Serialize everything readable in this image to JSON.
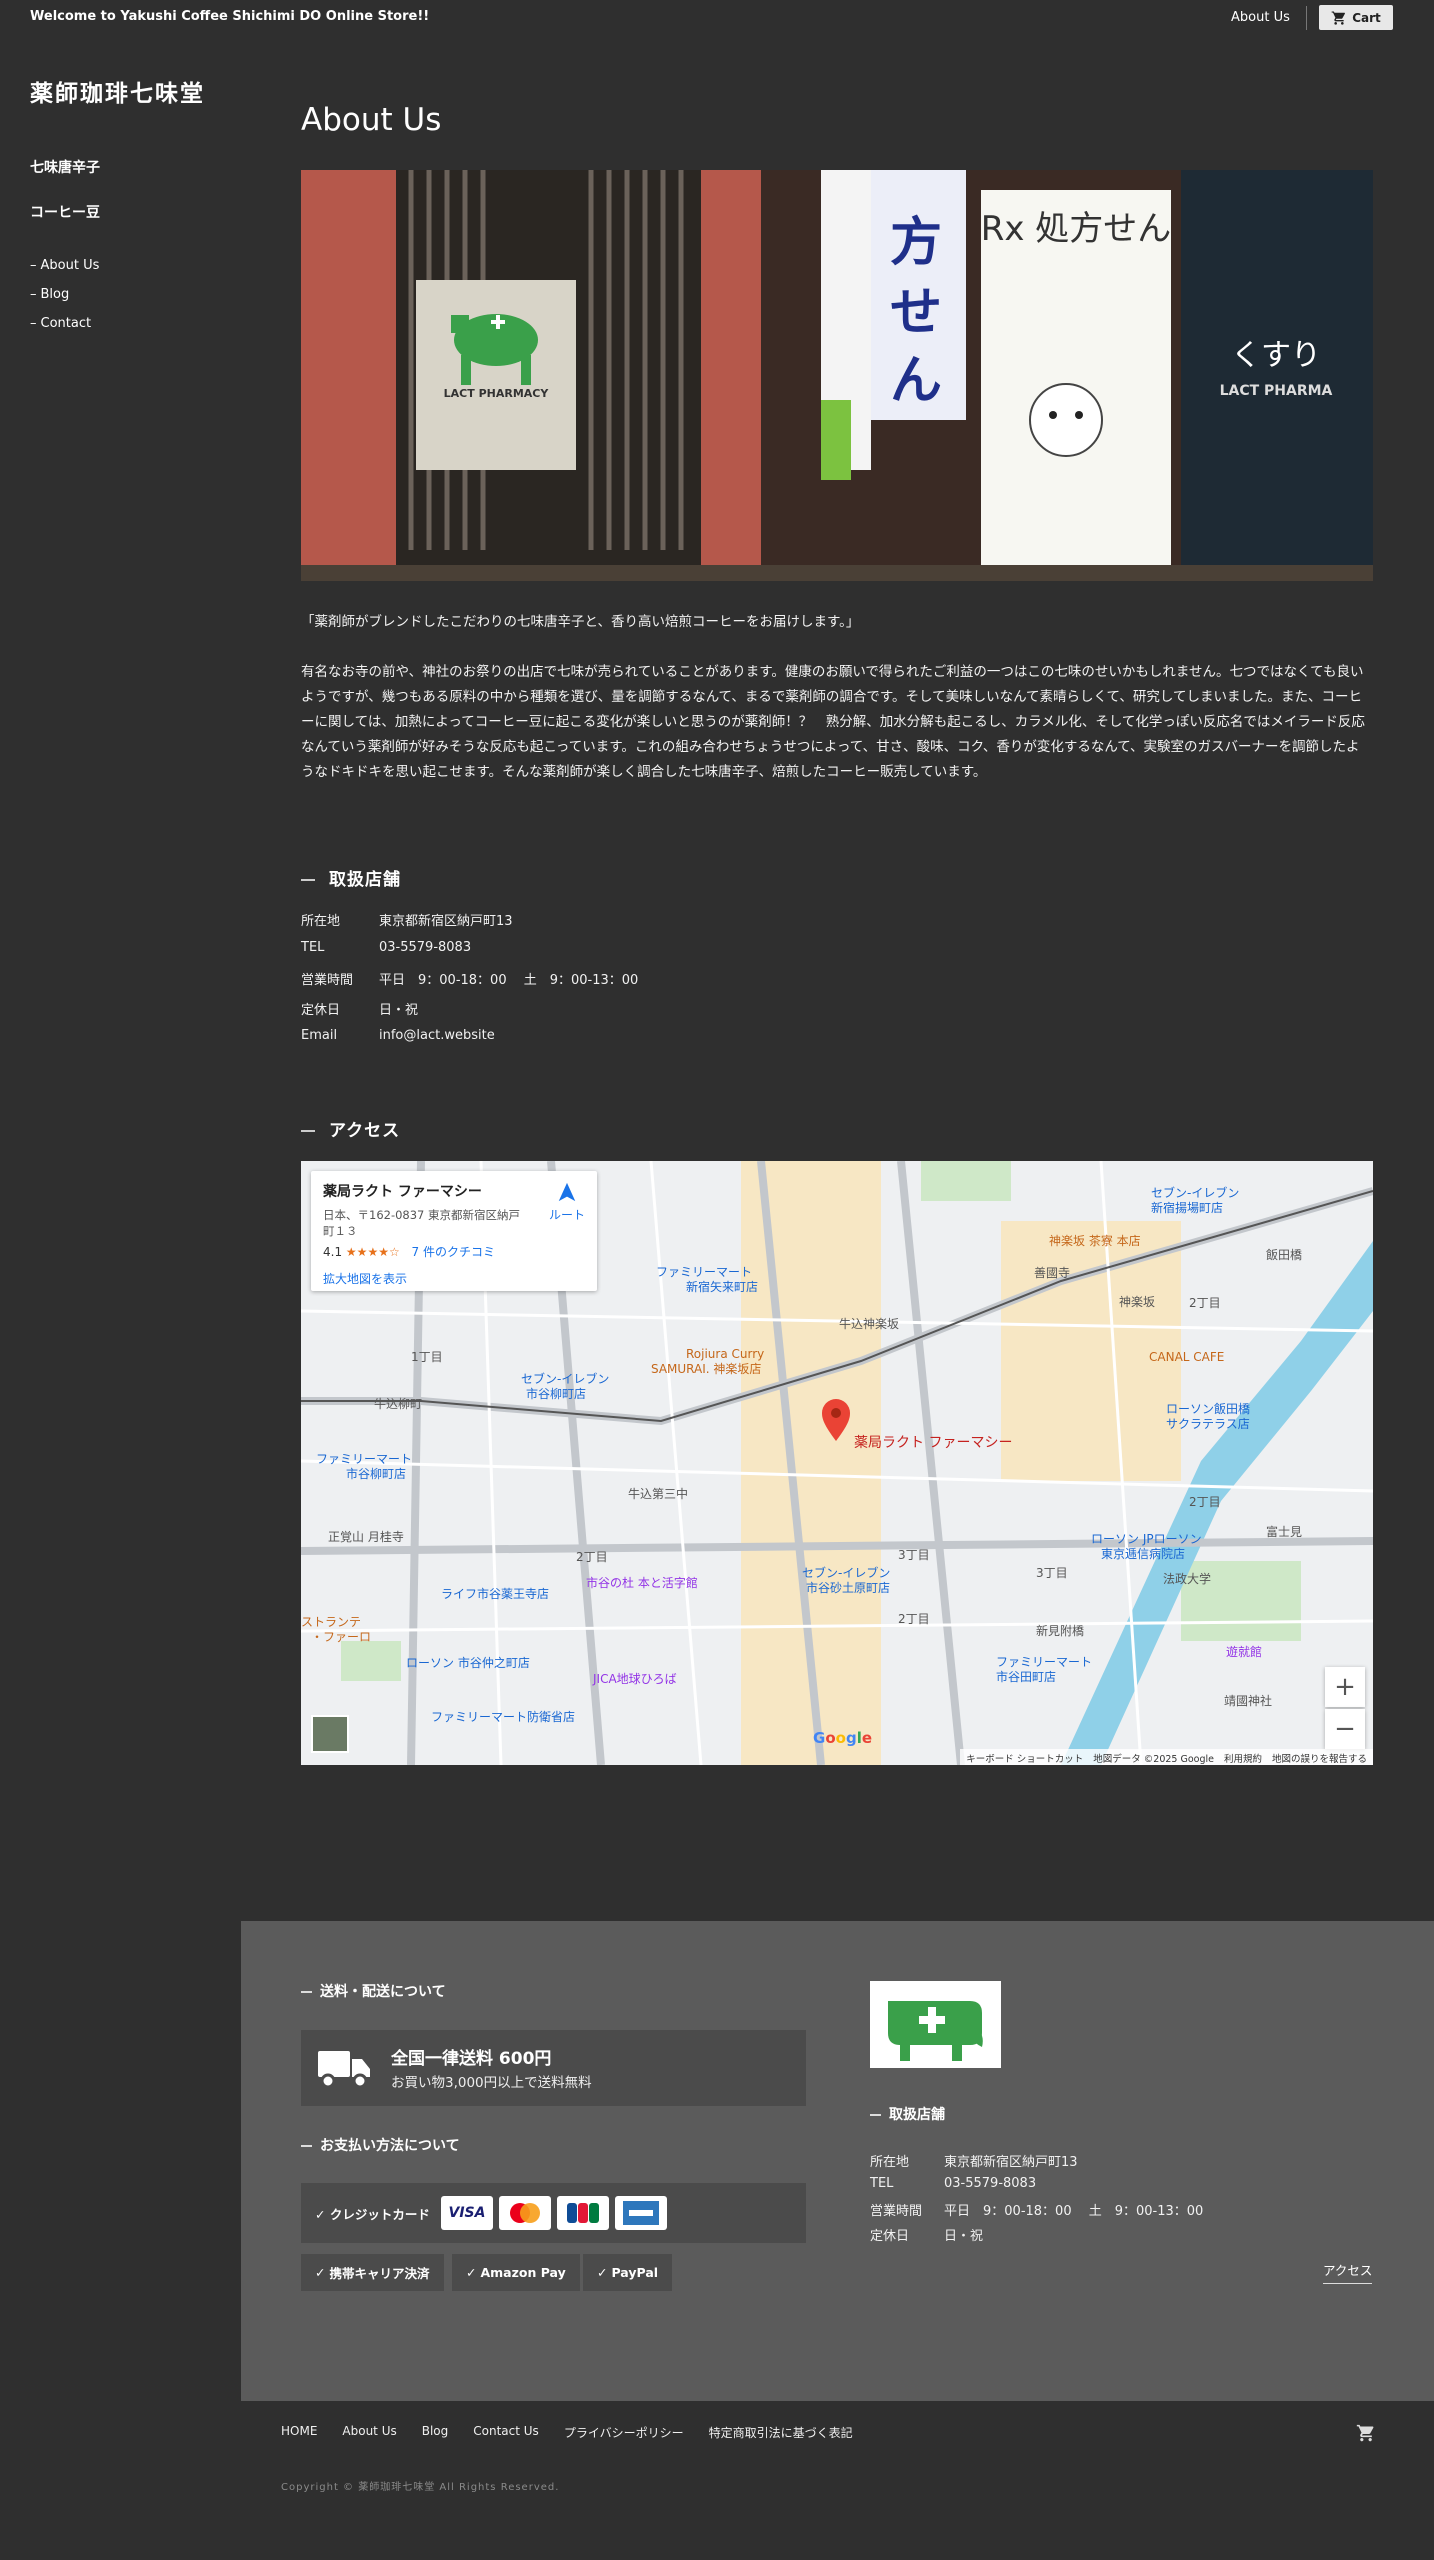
{
  "topbar": {
    "welcome": "Welcome to Yakushi Coffee Shichimi DO Online Store!!",
    "about": "About Us",
    "cart": "Cart"
  },
  "sidebar": {
    "site_title": "薬師珈琲七味堂",
    "categories": [
      "七味唐辛子",
      "コーヒー豆"
    ],
    "links": [
      "About Us",
      "Blog",
      "Contact"
    ]
  },
  "main": {
    "title": "About Us",
    "intro_quote": "「薬剤師がブレンドしたこだわりの七味唐辛子と、香り高い焙煎コーヒーをお届けします。」",
    "intro_body": "有名なお寺の前や、神社のお祭りの出店で七味が売られていることがあります。健康のお願いで得られたご利益の一つはこの七味のせいかもしれません。七つではなくても良いようですが、幾つもある原料の中から種類を選び、量を調節するなんて、まるで薬剤師の調合です。そして美味しいなんて素晴らしくて、研究してしまいました。また、コーヒーに関しては、加熱によってコーヒー豆に起こる変化が楽しいと思うのが薬剤師！？　熟分解、加水分解も起こるし、カラメル化、そして化学っぽい反応名ではメイラード反応なんていう薬剤師が好みそうな反応も起こっています。これの組み合わせちょうせつによって、甘さ、酸味、コク、香りが変化するなんて、実験室のガスバーナーを調節したようなドキドキを思い起こせます。そんな薬剤師が楽しく調合した七味唐辛子、焙煎したコーヒー販売しています。"
  },
  "shop": {
    "title": "取扱店舗",
    "rows": [
      {
        "k": "所在地",
        "v": "東京都新宿区納戸町13"
      },
      {
        "k": "TEL",
        "v": "03-5579-8083"
      },
      {
        "k": "営業時間",
        "v": "平日　9：00-18：00　 土　9：00-13：00"
      },
      {
        "k": "定休日",
        "v": "日・祝"
      },
      {
        "k": "Email",
        "v": "info@lact.website"
      }
    ]
  },
  "access": {
    "title": "アクセス",
    "place_name": "薬局ラクト ファーマシー",
    "place_address": "日本、〒162-0837 東京都新宿区納戸町１３",
    "rating": "4.1",
    "stars": "★★★★☆",
    "reviews": "7 件のクチコミ",
    "route": "ルート",
    "larger_map": "拡大地図を表示",
    "pin_label": "薬局ラクト ファーマシー",
    "google": "Google",
    "attribution": [
      "キーボード ショートカット",
      "地図データ ©2025 Google",
      "利用規約",
      "地図の誤りを報告する"
    ],
    "labels": [
      "ファミリーマート 新宿矢来町店",
      "牛込神楽坂",
      "Rojiura Curry SAMURAI. 神楽坂店",
      "セブン-イレブン 市谷柳町店",
      "牛込柳町",
      "ファミリーマート 市谷柳町店",
      "牛込第三中",
      "正覚山 月桂寺",
      "市谷の杜 本と活字館",
      "セブン-イレブン 市谷砂土原町店",
      "ライフ市谷薬王寺店",
      "ローソン 市谷仲之町店",
      "JICA地球ひろば",
      "ファミリーマート防衛省店",
      "神楽坂 茶寮 本店",
      "CANAL CAFE",
      "ローソン飯田橋 サクラテラス店",
      "ローソン JPローソン 東京逓信病院店",
      "飯田橋",
      "富士見",
      "法政大学",
      "靖國神社",
      "遊就館",
      "ファミリーマート 市谷田町店",
      "セブン-イレブン 新宿揚場町店",
      "善國寺",
      "神楽坂",
      "新見附橋",
      "1丁目",
      "2丁目",
      "3丁目"
    ]
  },
  "footer": {
    "shipping_title": "送料・配送について",
    "shipping_main": "全国一律送料 600円",
    "shipping_sub": "お買い物3,000円以上で送料無料",
    "payment_title": "お支払い方法について",
    "credit_label": "クレジットカード",
    "cards": [
      "VISA",
      "Mastercard",
      "JCB",
      "AMEX"
    ],
    "pay_chips": [
      "携帯キャリア決済",
      "Amazon Pay",
      "PayPal"
    ],
    "shop_title": "取扱店舗",
    "shop_rows": [
      {
        "k": "所在地",
        "v": "東京都新宿区納戸町13"
      },
      {
        "k": "TEL",
        "v": "03-5579-8083"
      },
      {
        "k": "営業時間",
        "v": "平日　9：00-18：00　 土　9：00-13：00"
      },
      {
        "k": "定休日",
        "v": "日・祝"
      }
    ],
    "access_link": "アクセス"
  },
  "bottom": {
    "nav": [
      "HOME",
      "About Us",
      "Blog",
      "Contact Us",
      "プライバシーポリシー",
      "特定商取引法に基づく表記"
    ],
    "copyright": "Copyright © 薬師珈琲七味堂 All Rights Reserved."
  },
  "colors": {
    "background": "#2f2f2f",
    "footer_bg": "#5b5b5b",
    "brand_green": "#3aa04a",
    "map_pin": "#ea4335",
    "link_blue": "#1a73e8"
  }
}
